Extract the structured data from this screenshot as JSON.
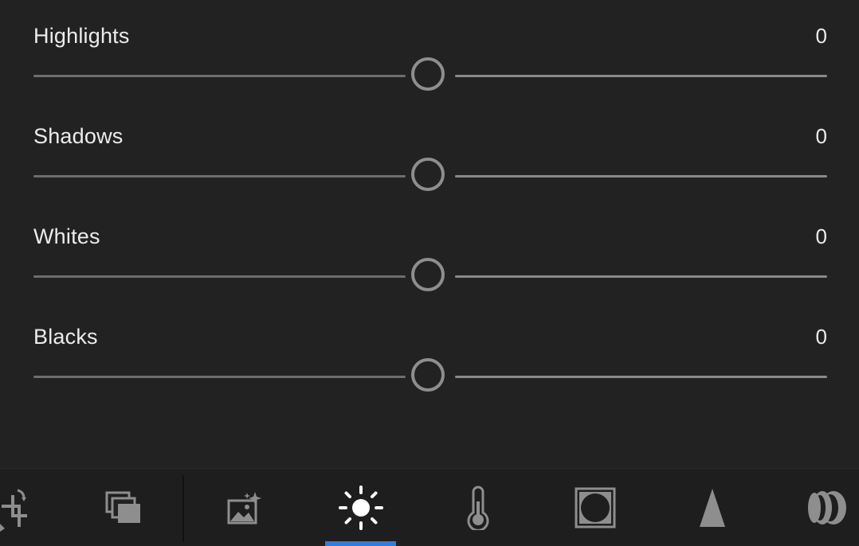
{
  "sliders": [
    {
      "label": "Highlights",
      "value": "0",
      "level": 0.5
    },
    {
      "label": "Shadows",
      "value": "0",
      "level": 0.5
    },
    {
      "label": "Whites",
      "value": "0",
      "level": 0.5
    },
    {
      "label": "Blacks",
      "value": "0",
      "level": 0.5
    }
  ],
  "toolbar": {
    "tools": [
      {
        "name": "crop-rotate-icon",
        "active": false
      },
      {
        "name": "presets-icon",
        "active": false
      },
      {
        "name": "auto-enhance-icon",
        "active": false
      },
      {
        "name": "light-icon",
        "active": true
      },
      {
        "name": "color-temperature-icon",
        "active": false
      },
      {
        "name": "vignette-icon",
        "active": false
      },
      {
        "name": "detail-icon",
        "active": false
      },
      {
        "name": "optics-icon",
        "active": false
      }
    ]
  },
  "colors": {
    "background": "#222222",
    "toolbar_background": "#1e1e1e",
    "accent": "#2f7de1",
    "slider_track": "#7a7a7a",
    "slider_thumb": "#8e8e8e",
    "text": "#ececec"
  }
}
